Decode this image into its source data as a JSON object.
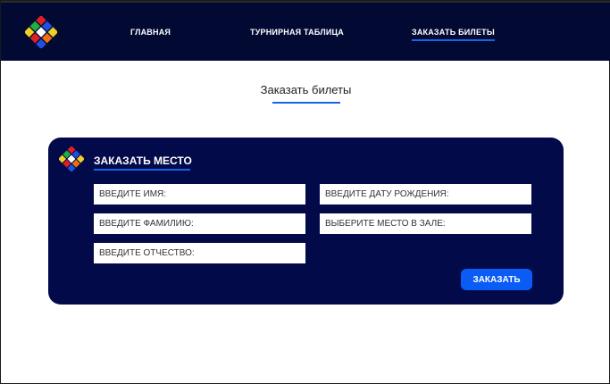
{
  "nav": {
    "home": "ГЛАВНАЯ",
    "table": "ТУРНИРНАЯ ТАБЛИЦА",
    "tickets": "ЗАКАЗАТЬ БИЛЕТЫ"
  },
  "page": {
    "title": "Заказать билеты"
  },
  "form": {
    "title": "ЗАКАЗАТЬ МЕСТО",
    "first_name_placeholder": "ВВЕДИТЕ ИМЯ:",
    "last_name_placeholder": "ВВЕДИТЕ ФАМИЛИЮ:",
    "patronymic_placeholder": "ВВЕДИТЕ ОТЧЕСТВО:",
    "birth_date_placeholder": "ВВЕДИТЕ ДАТУ РОЖДЕНИЯ:",
    "seat_placeholder": "ВЫБЕРИТЕ МЕСТО В ЗАЛЕ:",
    "submit_label": "ЗАКАЗАТЬ"
  },
  "icons": {
    "logo": "rubiks-cube-icon"
  },
  "colors": {
    "header_bg": "#020a33",
    "card_bg": "#020a4a",
    "accent": "#1565e8",
    "button": "#0a5cf5"
  }
}
